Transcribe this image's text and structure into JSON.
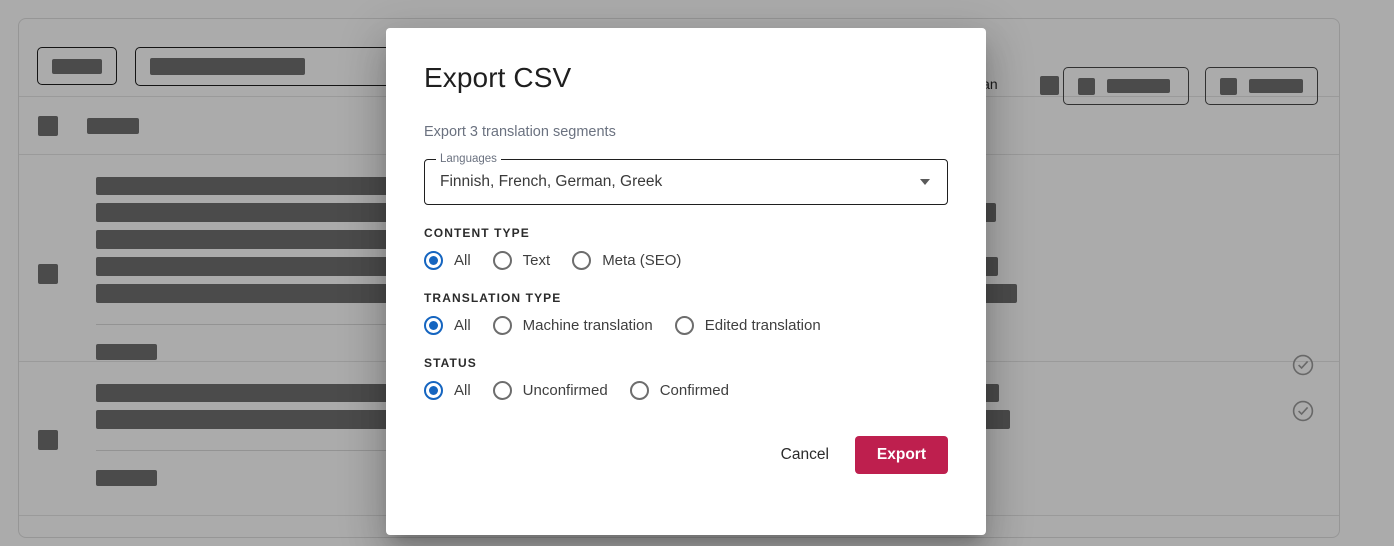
{
  "dialog": {
    "title": "Export CSV",
    "subtitle": "Export 3 translation segments",
    "languages_label": "Languages",
    "languages_value": "Finnish, French, German, Greek",
    "caret_icon": "chevron-down-icon",
    "groups": [
      {
        "label": "CONTENT TYPE",
        "options": [
          {
            "label": "All",
            "selected": true
          },
          {
            "label": "Text",
            "selected": false
          },
          {
            "label": "Meta (SEO)",
            "selected": false
          }
        ]
      },
      {
        "label": "TRANSLATION TYPE",
        "options": [
          {
            "label": "All",
            "selected": true
          },
          {
            "label": "Machine translation",
            "selected": false
          },
          {
            "label": "Edited translation",
            "selected": false
          }
        ]
      },
      {
        "label": "STATUS",
        "options": [
          {
            "label": "All",
            "selected": true
          },
          {
            "label": "Unconfirmed",
            "selected": false
          },
          {
            "label": "Confirmed",
            "selected": false
          }
        ]
      }
    ],
    "cancel_label": "Cancel",
    "export_label": "Export",
    "accent_color": "#be1f4e",
    "radio_color": "#1565c0"
  },
  "background": {
    "partial_language_text": "ian",
    "check_icon": "check-circle-icon"
  }
}
